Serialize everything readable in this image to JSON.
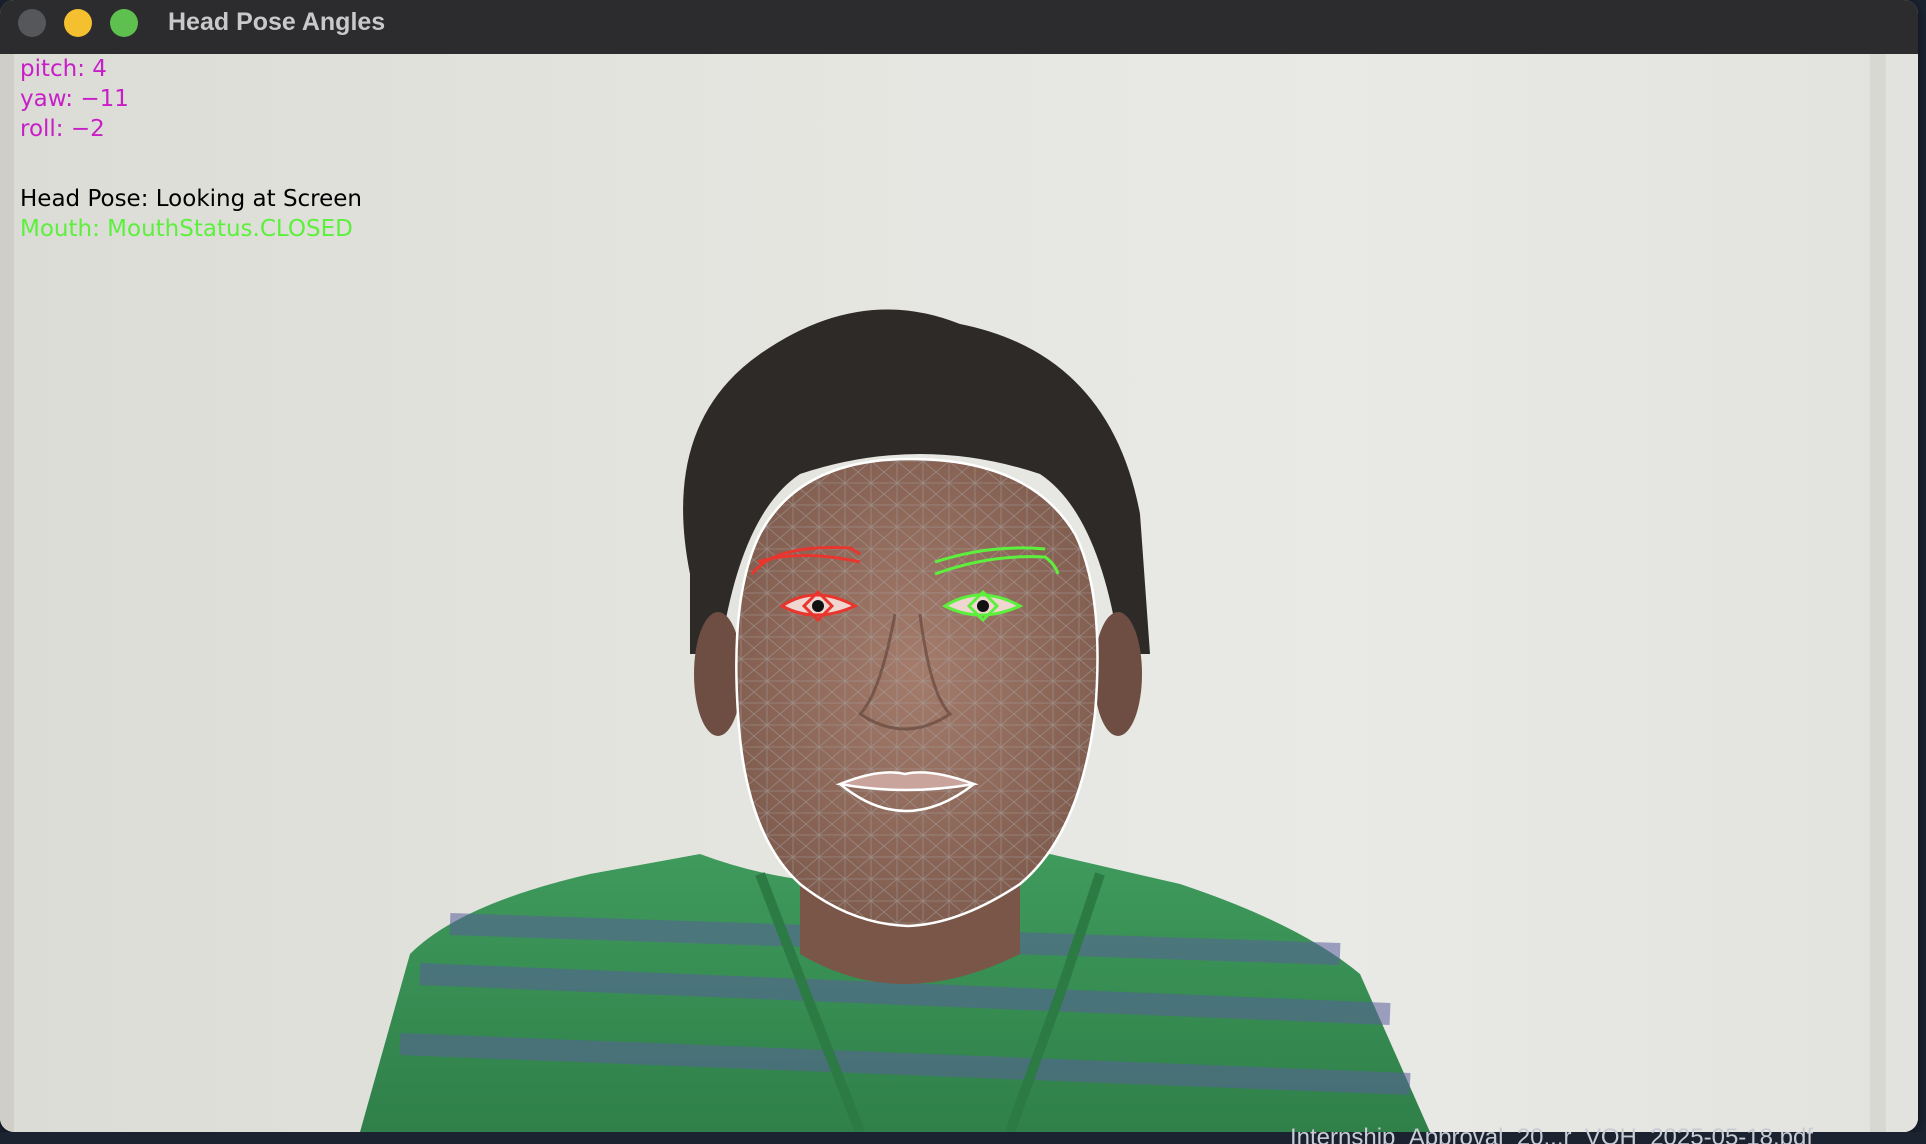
{
  "window": {
    "title": "Head Pose Angles"
  },
  "overlay": {
    "pitch": "pitch: 4",
    "yaw": "yaw: −11",
    "roll": "roll: −2",
    "head_pose": "Head Pose: Looking at Screen",
    "mouth": "Mouth: MouthStatus.CLOSED"
  },
  "colors": {
    "angle_text": "#c81ec8",
    "head_pose_text": "#000000",
    "mouth_text": "#5cf03c",
    "left_eye_outline": "#e8362e",
    "right_eye_outline": "#5cf03c",
    "face_outline": "#ffffff",
    "mesh": "#9a9a9a"
  },
  "background_dock": {
    "file_label": "Internship_Approval_20...r_VOH_2025-05-18.pdf"
  }
}
